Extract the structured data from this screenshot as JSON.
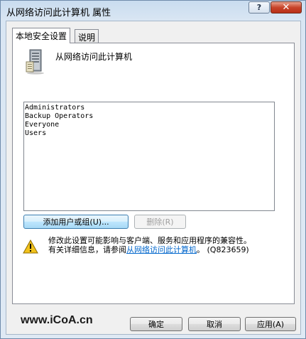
{
  "window": {
    "title": "从网络访问此计算机 属性",
    "help_glyph": "?",
    "close_glyph": "✕"
  },
  "tabs": [
    {
      "label": "本地安全设置",
      "active": true
    },
    {
      "label": "说明",
      "active": false
    }
  ],
  "policy": {
    "name": "从网络访问此计算机",
    "icon": "server-icon"
  },
  "accounts": [
    "Administrators",
    "Backup Operators",
    "Everyone",
    "Users"
  ],
  "buttons": {
    "add": "添加用户或组(U)...",
    "remove": "删除(R)",
    "ok": "确定",
    "cancel": "取消",
    "apply": "应用(A)"
  },
  "warning": {
    "icon": "warning-icon",
    "line1": "修改此设置可能影响与客户端、服务和应用程序的兼容性。",
    "line2_prefix": "有关详细信息，请参阅",
    "line2_link": "从网络访问此计算机",
    "line2_suffix": "。 (Q823659)"
  },
  "watermark": "www.iCoA.cn",
  "colors": {
    "link": "#0066cc",
    "close_button": "#c8452b",
    "warning_fill": "#f2c21b"
  }
}
